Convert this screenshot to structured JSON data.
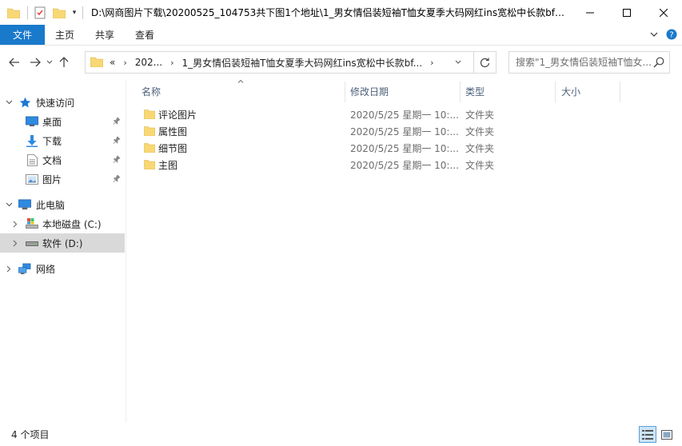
{
  "window": {
    "title": "D:\\网商图片下载\\20200525_104753共下图1个地址\\1_男女情侣装短袖T恤女夏季大码网红ins宽松中长款bf风..."
  },
  "ribbon": {
    "tabs": [
      {
        "label": "文件"
      },
      {
        "label": "主页"
      },
      {
        "label": "共享"
      },
      {
        "label": "查看"
      }
    ]
  },
  "address": {
    "overflow": "«",
    "crumbs": [
      "202...",
      "1_男女情侣装短袖T恤女夏季大码网红ins宽松中长款bf..."
    ]
  },
  "search": {
    "placeholder": "搜索\"1_男女情侣装短袖T恤女..."
  },
  "sidebar": {
    "items": [
      {
        "label": "快速访问",
        "icon": "star-icon"
      },
      {
        "label": "桌面",
        "icon": "desktop-icon"
      },
      {
        "label": "下载",
        "icon": "download-icon"
      },
      {
        "label": "文档",
        "icon": "documents-icon"
      },
      {
        "label": "图片",
        "icon": "pictures-icon"
      },
      {
        "label": "此电脑",
        "icon": "this-pc-icon"
      },
      {
        "label": "本地磁盘 (C:)",
        "icon": "drive-c-icon"
      },
      {
        "label": "软件 (D:)",
        "icon": "drive-d-icon"
      },
      {
        "label": "网络",
        "icon": "network-icon"
      }
    ]
  },
  "columns": {
    "name": "名称",
    "date": "修改日期",
    "type": "类型",
    "size": "大小"
  },
  "files": [
    {
      "name": "评论图片",
      "date": "2020/5/25 星期一 10:...",
      "type": "文件夹"
    },
    {
      "name": "属性图",
      "date": "2020/5/25 星期一 10:...",
      "type": "文件夹"
    },
    {
      "name": "细节图",
      "date": "2020/5/25 星期一 10:...",
      "type": "文件夹"
    },
    {
      "name": "主图",
      "date": "2020/5/25 星期一 10:...",
      "type": "文件夹"
    }
  ],
  "status": {
    "count": "4 个项目"
  },
  "colors": {
    "accent": "#1979ca",
    "folder": "#f8d775",
    "header_text": "#4c607a",
    "selected": "#d9d9d9"
  }
}
